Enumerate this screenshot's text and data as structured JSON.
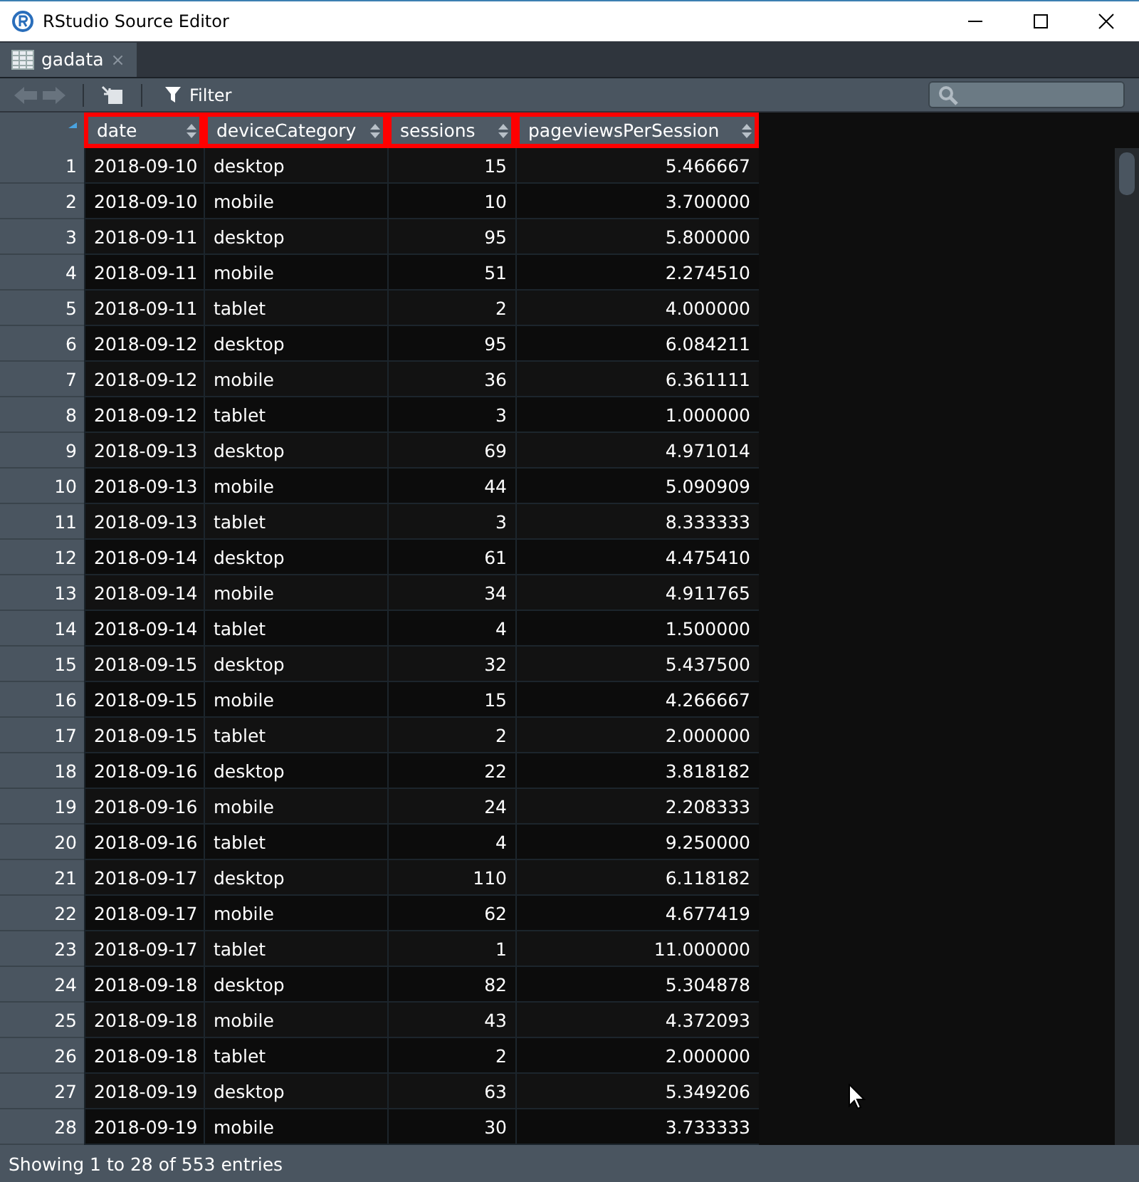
{
  "window": {
    "title": "RStudio Source Editor"
  },
  "tabs": [
    {
      "label": "gadata",
      "selected": true,
      "close": "×"
    }
  ],
  "toolbar": {
    "filter_label": "Filter"
  },
  "table": {
    "columns": [
      {
        "label": "date",
        "kind": "text",
        "highlighted": true
      },
      {
        "label": "deviceCategory",
        "kind": "text",
        "highlighted": true
      },
      {
        "label": "sessions",
        "kind": "number",
        "highlighted": true
      },
      {
        "label": "pageviewsPerSession",
        "kind": "number",
        "highlighted": true
      }
    ],
    "rows": [
      {
        "row_number": "1",
        "cells": [
          "2018-09-10",
          "desktop",
          "15",
          "5.466667"
        ]
      },
      {
        "row_number": "2",
        "cells": [
          "2018-09-10",
          "mobile",
          "10",
          "3.700000"
        ]
      },
      {
        "row_number": "3",
        "cells": [
          "2018-09-11",
          "desktop",
          "95",
          "5.800000"
        ]
      },
      {
        "row_number": "4",
        "cells": [
          "2018-09-11",
          "mobile",
          "51",
          "2.274510"
        ]
      },
      {
        "row_number": "5",
        "cells": [
          "2018-09-11",
          "tablet",
          "2",
          "4.000000"
        ]
      },
      {
        "row_number": "6",
        "cells": [
          "2018-09-12",
          "desktop",
          "95",
          "6.084211"
        ]
      },
      {
        "row_number": "7",
        "cells": [
          "2018-09-12",
          "mobile",
          "36",
          "6.361111"
        ]
      },
      {
        "row_number": "8",
        "cells": [
          "2018-09-12",
          "tablet",
          "3",
          "1.000000"
        ]
      },
      {
        "row_number": "9",
        "cells": [
          "2018-09-13",
          "desktop",
          "69",
          "4.971014"
        ]
      },
      {
        "row_number": "10",
        "cells": [
          "2018-09-13",
          "mobile",
          "44",
          "5.090909"
        ]
      },
      {
        "row_number": "11",
        "cells": [
          "2018-09-13",
          "tablet",
          "3",
          "8.333333"
        ]
      },
      {
        "row_number": "12",
        "cells": [
          "2018-09-14",
          "desktop",
          "61",
          "4.475410"
        ]
      },
      {
        "row_number": "13",
        "cells": [
          "2018-09-14",
          "mobile",
          "34",
          "4.911765"
        ]
      },
      {
        "row_number": "14",
        "cells": [
          "2018-09-14",
          "tablet",
          "4",
          "1.500000"
        ]
      },
      {
        "row_number": "15",
        "cells": [
          "2018-09-15",
          "desktop",
          "32",
          "5.437500"
        ]
      },
      {
        "row_number": "16",
        "cells": [
          "2018-09-15",
          "mobile",
          "15",
          "4.266667"
        ]
      },
      {
        "row_number": "17",
        "cells": [
          "2018-09-15",
          "tablet",
          "2",
          "2.000000"
        ]
      },
      {
        "row_number": "18",
        "cells": [
          "2018-09-16",
          "desktop",
          "22",
          "3.818182"
        ]
      },
      {
        "row_number": "19",
        "cells": [
          "2018-09-16",
          "mobile",
          "24",
          "2.208333"
        ]
      },
      {
        "row_number": "20",
        "cells": [
          "2018-09-16",
          "tablet",
          "4",
          "9.250000"
        ]
      },
      {
        "row_number": "21",
        "cells": [
          "2018-09-17",
          "desktop",
          "110",
          "6.118182"
        ]
      },
      {
        "row_number": "22",
        "cells": [
          "2018-09-17",
          "mobile",
          "62",
          "4.677419"
        ]
      },
      {
        "row_number": "23",
        "cells": [
          "2018-09-17",
          "tablet",
          "1",
          "11.000000"
        ]
      },
      {
        "row_number": "24",
        "cells": [
          "2018-09-18",
          "desktop",
          "82",
          "5.304878"
        ]
      },
      {
        "row_number": "25",
        "cells": [
          "2018-09-18",
          "mobile",
          "43",
          "4.372093"
        ]
      },
      {
        "row_number": "26",
        "cells": [
          "2018-09-18",
          "tablet",
          "2",
          "2.000000"
        ]
      },
      {
        "row_number": "27",
        "cells": [
          "2018-09-19",
          "desktop",
          "63",
          "5.349206"
        ]
      },
      {
        "row_number": "28",
        "cells": [
          "2018-09-19",
          "mobile",
          "30",
          "3.733333"
        ]
      }
    ]
  },
  "status_bar": "Showing 1 to 28 of 553 entries"
}
